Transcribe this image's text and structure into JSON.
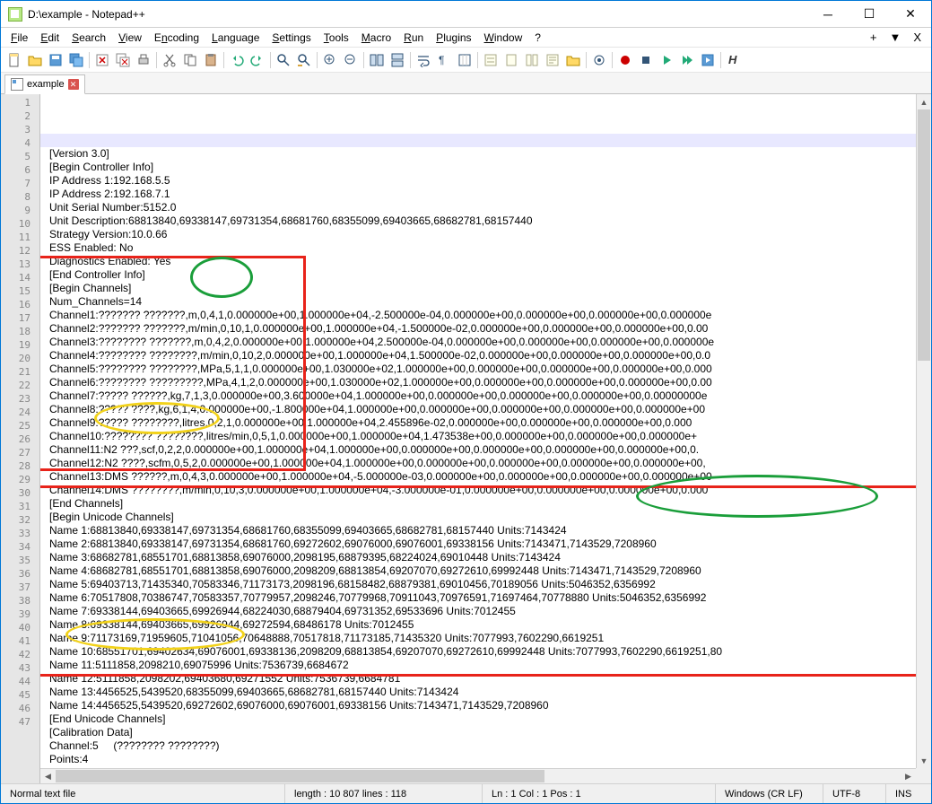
{
  "window": {
    "title": "D:\\example - Notepad++"
  },
  "menu": {
    "items": [
      {
        "label": "File",
        "u": 0
      },
      {
        "label": "Edit",
        "u": 0
      },
      {
        "label": "Search",
        "u": 0
      },
      {
        "label": "View",
        "u": 0
      },
      {
        "label": "Encoding",
        "u": 1
      },
      {
        "label": "Language",
        "u": 0
      },
      {
        "label": "Settings",
        "u": 0
      },
      {
        "label": "Tools",
        "u": 0
      },
      {
        "label": "Macro",
        "u": 0
      },
      {
        "label": "Run",
        "u": 0
      },
      {
        "label": "Plugins",
        "u": 0
      },
      {
        "label": "Window",
        "u": 0
      },
      {
        "label": "?",
        "u": -1
      }
    ],
    "extra": [
      "+",
      "▼",
      "X"
    ]
  },
  "tab": {
    "label": "example"
  },
  "status": {
    "filetype": "Normal text file",
    "length": "length : 10 807    lines : 118",
    "pos": "Ln : 1    Col : 1    Pos : 1",
    "eol": "Windows (CR LF)",
    "enc": "UTF-8",
    "mode": "INS"
  },
  "lines": [
    "",
    "[Version 3.0]",
    "[Begin Controller Info]",
    "IP Address 1:192.168.5.5",
    "IP Address 2:192.168.7.1",
    "Unit Serial Number:5152.0",
    "Unit Description:68813840,69338147,69731354,68681760,68355099,69403665,68682781,68157440",
    "Strategy Version:10.0.66",
    "ESS Enabled: No",
    "Diagnostics Enabled: Yes",
    "[End Controller Info]",
    "[Begin Channels]",
    "Num_Channels=14",
    "Channel1:??????? ???????,m,0,4,1,0.000000e+00,1.000000e+04,-2.500000e-04,0.000000e+00,0.000000e+00,0.000000e+00,0.000000e",
    "Channel2:??????? ???????,m/min,0,10,1,0.000000e+00,1.000000e+04,-1.500000e-02,0.000000e+00,0.000000e+00,0.000000e+00,0.00",
    "Channel3:???????? ???????,m,0,4,2,0.000000e+00,1.000000e+04,2.500000e-04,0.000000e+00,0.000000e+00,0.000000e+00,0.000000e",
    "Channel4:???????? ????????,m/min,0,10,2,0.000000e+00,1.000000e+04,1.500000e-02,0.000000e+00,0.000000e+00,0.000000e+00,0.0",
    "Channel5:???????? ????????,MPa,5,1,1,0.000000e+00,1.030000e+02,1.000000e+00,0.000000e+00,0.000000e+00,0.000000e+00,0.000",
    "Channel6:???????? ?????????,MPa,4,1,2,0.000000e+00,1.030000e+02,1.000000e+00,0.000000e+00,0.000000e+00,0.000000e+00,0.00",
    "Channel7:????? ??????,kg,7,1,3,0.000000e+00,3.600000e+04,1.000000e+00,0.000000e+00,0.000000e+00,0.000000e+00,0.00000000e",
    "Channel8:????? ????,kg,6,1,4,0.000000e+00,-1.800000e+04,1.000000e+00,0.000000e+00,0.000000e+00,0.000000e+00,0.000000e+00",
    "Channel9:????? ????????,litres,0,2,1,0.000000e+00,1.000000e+04,2.455896e-02,0.000000e+00,0.000000e+00,0.000000e+00,0.000",
    "Channel10:???????? ????????,litres/min,0,5,1,0.000000e+00,1.000000e+04,1.473538e+00,0.000000e+00,0.000000e+00,0.000000e+",
    "Channel11:N2 ???,scf,0,2,2,0.000000e+00,1.000000e+04,1.000000e+00,0.000000e+00,0.000000e+00,0.000000e+00,0.000000e+00,0.",
    "Channel12:N2 ????,scfm,0,5,2,0.000000e+00,1.000000e+04,1.000000e+00,0.000000e+00,0.000000e+00,0.000000e+00,0.000000e+00,",
    "Channel13:DMS ??????,m,0,4,3,0.000000e+00,1.000000e+04,-5.000000e-03,0.000000e+00,0.000000e+00,0.000000e+00,0.000000e+00",
    "Channel14:DMS ????????,m/min,0,10,3,0.000000e+00,1.000000e+04,-3.000000e-01,0.000000e+00,0.000000e+00,0.000000e+00,0.000",
    "[End Channels]",
    "[Begin Unicode Channels]",
    "Name 1:68813840,69338147,69731354,68681760,68355099,69403665,68682781,68157440 Units:7143424",
    "Name 2:68813840,69338147,69731354,68681760,69272602,69076000,69076001,69338156 Units:7143471,7143529,7208960",
    "Name 3:68682781,68551701,68813858,69076000,2098195,68879395,68224024,69010448 Units:7143424",
    "Name 4:68682781,68551701,68813858,69076000,2098209,68813854,69207070,69272610,69992448 Units:7143471,7143529,7208960",
    "Name 5:69403713,71435340,70583346,71173173,2098196,68158482,68879381,69010456,70189056 Units:5046352,6356992",
    "Name 6:70517808,70386747,70583357,70779957,2098246,70779968,70911043,70976591,71697464,70778880 Units:5046352,6356992",
    "Name 7:69338144,69403665,69926944,68224030,68879404,69731352,69533696 Units:7012455",
    "Name 8:69338144,69403665,69926944,69272594,68486178 Units:7012455",
    "Name 9:71173169,71959605,71041056,70648888,70517818,71173185,71435320 Units:7077993,7602290,6619251",
    "Name 10:68551701,69402634,69076001,69338136,2098209,68813854,69207070,69272610,69992448 Units:7077993,7602290,6619251,80",
    "Name 11:5111858,2098210,69075996 Units:7536739,6684672",
    "Name 12:5111858,2098202,69403680,69271552 Units:7536739,6684781",
    "Name 13:4456525,5439520,68355099,69403665,68682781,68157440 Units:7143424",
    "Name 14:4456525,5439520,69272602,69076000,69076001,69338156 Units:7143471,7143529,7208960",
    "[End Unicode Channels]",
    "[Calibration Data]",
    "Channel:5     (???????? ????????)",
    "Points:4"
  ]
}
